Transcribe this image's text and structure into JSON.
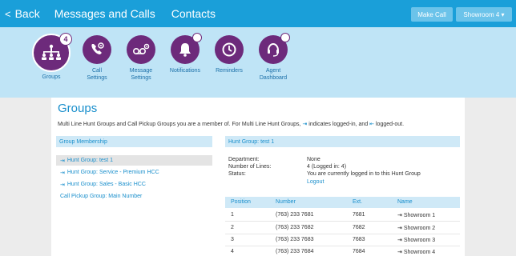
{
  "topbar": {
    "back_label": "Back",
    "nav": [
      "Messages and Calls",
      "Contacts"
    ],
    "make_call": "Make Call",
    "showroom": "Showroom 4 ▾"
  },
  "icons": [
    {
      "label_1": "Groups",
      "label_2": "",
      "badge": "4",
      "icon": "group-icon"
    },
    {
      "label_1": "Call",
      "label_2": "Settings",
      "icon": "phone-settings-icon"
    },
    {
      "label_1": "Message",
      "label_2": "Settings",
      "icon": "voicemail-settings-icon"
    },
    {
      "label_1": "Notifications",
      "label_2": "",
      "icon": "bell-icon"
    },
    {
      "label_1": "Reminders",
      "label_2": "",
      "icon": "clock-icon"
    },
    {
      "label_1": "Agent",
      "label_2": "Dashboard",
      "icon": "headset-icon"
    }
  ],
  "page": {
    "title": "Groups",
    "desc_1": "Multi Line Hunt Groups and Call Pickup Groups you are a member of. For Multi Line Hunt Groups,",
    "desc_2": "indicates logged-in, and",
    "desc_3": "logged-out."
  },
  "membership": {
    "header": "Group Membership",
    "items": [
      "Hunt Group: test 1",
      "Hunt Group: Service - Premium HCC",
      "Hunt Group: Sales - Basic HCC",
      "Call Pickup Group: Main Number"
    ]
  },
  "detail": {
    "header": "Hunt Group: test 1",
    "department_label": "Department:",
    "department_value": "None",
    "lines_label": "Number of Lines:",
    "lines_value": "4  (Logged in: 4)",
    "status_label": "Status:",
    "status_value": "You are currently logged in to this Hunt Group",
    "logout": "Logout"
  },
  "table": {
    "headers": [
      "Position",
      "Number",
      "Ext.",
      "Name"
    ],
    "rows": [
      [
        "1",
        "(763) 233 7681",
        "7681",
        "Showroom 1"
      ],
      [
        "2",
        "(763) 233 7682",
        "7682",
        "Showroom 2"
      ],
      [
        "3",
        "(763) 233 7683",
        "7683",
        "Showroom 3"
      ],
      [
        "4",
        "(763) 233 7684",
        "7684",
        "Showroom 4"
      ]
    ]
  },
  "colors": {
    "topbar": "#1a9fd9",
    "iconbar": "#bfe4f6",
    "icon_circle": "#6d2a7b",
    "link": "#1a8fcc"
  }
}
